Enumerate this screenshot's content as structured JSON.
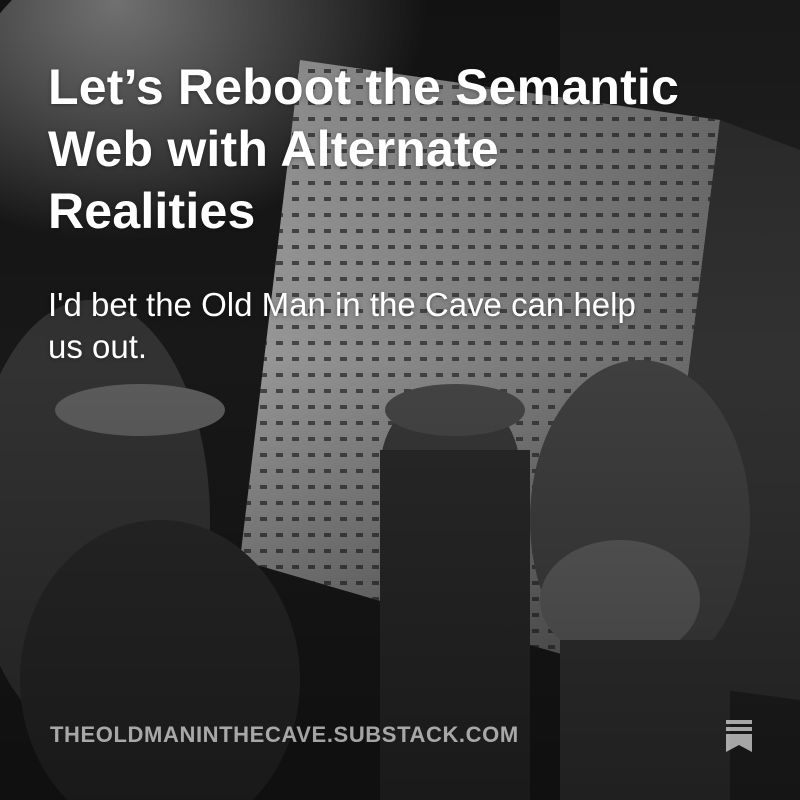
{
  "post": {
    "title": "Let’s Reboot the Semantic Web with Alternate Realities",
    "subtitle": "I'd bet the Old Man in the Cave can help us out.",
    "domain": "THEOLDMANINTHECAVE.SUBSTACK.COM"
  },
  "icons": {
    "publisher": "bookmark-icon"
  },
  "colors": {
    "text": "#ffffff",
    "domain_text": "#a8a8a8"
  }
}
